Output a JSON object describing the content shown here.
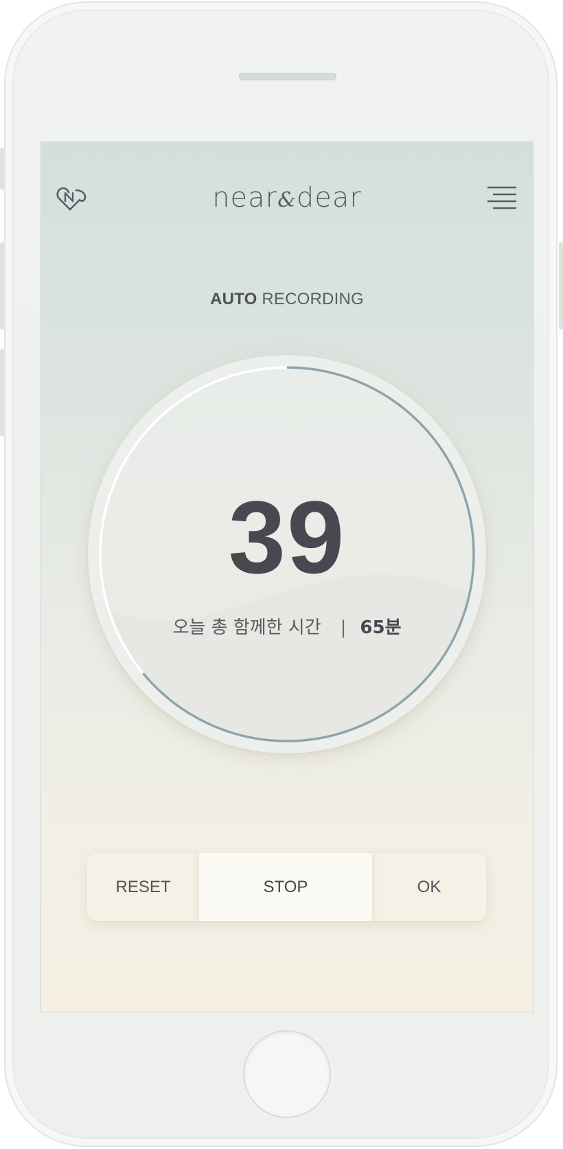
{
  "app": {
    "brand_name": "near&dear",
    "brand_parts": {
      "left": "near",
      "amp": "&",
      "right": "dear"
    }
  },
  "header": {
    "logo_icon": "heart-nd-icon",
    "menu_icon": "hamburger-menu-icon"
  },
  "mode": {
    "bold_part": "AUTO",
    "rest": "RECORDING"
  },
  "dial": {
    "count": "39",
    "progress": 0.64,
    "today_label": "오늘 총 함께한 시간",
    "separator": "|",
    "today_total": "65분"
  },
  "controls": {
    "reset_label": "RESET",
    "stop_label": "STOP",
    "ok_label": "OK"
  },
  "colors": {
    "accent": "#8ea4ad",
    "text_dark": "#4a4751",
    "screen_top": "#d4dfdc",
    "screen_bottom": "#f6f0e4"
  }
}
